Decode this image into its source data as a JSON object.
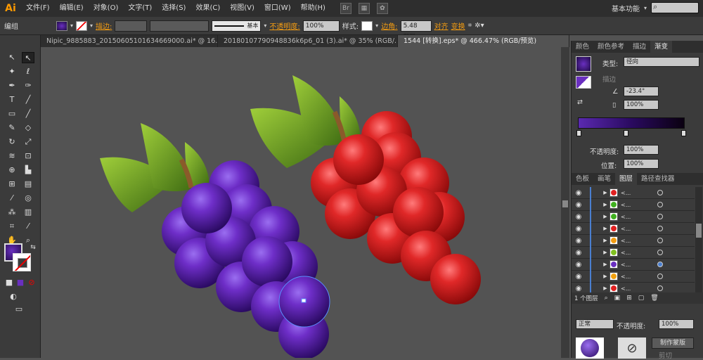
{
  "app": {
    "logo": "Ai",
    "workspace": "基本功能",
    "search_placeholder": ""
  },
  "menu": [
    "文件(F)",
    "编辑(E)",
    "对象(O)",
    "文字(T)",
    "选择(S)",
    "效果(C)",
    "视图(V)",
    "窗口(W)",
    "帮助(H)"
  ],
  "control": {
    "selection": "编组",
    "stroke_label": "描边:",
    "stroke_style": "基本",
    "opacity_label": "不透明度:",
    "opacity_value": "100%",
    "style_label": "样式:",
    "corner_label": "边角:",
    "corner_value": "5.48 mm",
    "align_label": "对齐",
    "transform_label": "变换"
  },
  "tabs": [
    {
      "label": "Nipic_9885883_20150605101634669000.ai* @ 16..."
    },
    {
      "label": "20180107790948836k6p6_01 (3).ai* @ 35% (RGB/..."
    },
    {
      "label": "1544 [转换].eps* @ 466.47% (RGB/预览)"
    }
  ],
  "gradient_panel": {
    "tabs": [
      "颜色",
      "颜色参考",
      "描边",
      "渐变"
    ],
    "type_label": "类型:",
    "type_value": "径向",
    "stroke_label": "描边",
    "angle_value": "-23.4°",
    "ratio_value": "100%",
    "opacity_label": "不透明度:",
    "opacity_value": "100%",
    "position_label": "位置:",
    "position_value": "100%"
  },
  "layers_panel": {
    "tabs": [
      "色板",
      "画笔",
      "图层",
      "路径查找器"
    ],
    "rows": [
      {
        "name": "<...",
        "color": "#e02020"
      },
      {
        "name": "<...",
        "color": "#40b020"
      },
      {
        "name": "<...",
        "color": "#40b020"
      },
      {
        "name": "<...",
        "color": "#e02020"
      },
      {
        "name": "<...",
        "color": "#f39c12"
      },
      {
        "name": "<...",
        "color": "#80c020"
      },
      {
        "name": "<...",
        "color": "#6a2fc0"
      },
      {
        "name": "<...",
        "color": "#f0a010"
      },
      {
        "name": "<...",
        "color": "#e02020"
      }
    ],
    "footer_label": "1 个图层"
  },
  "transparency_panel": {
    "mode": "正常",
    "opacity_label": "不透明度:",
    "opacity_value": "100%",
    "make_mask_button": "制作蒙版",
    "clip_label": "剪切"
  },
  "colors": {
    "purple": "#6a2fc0",
    "red": "#d42020",
    "leaf": "#6aa020",
    "accent": "#f39c12"
  }
}
